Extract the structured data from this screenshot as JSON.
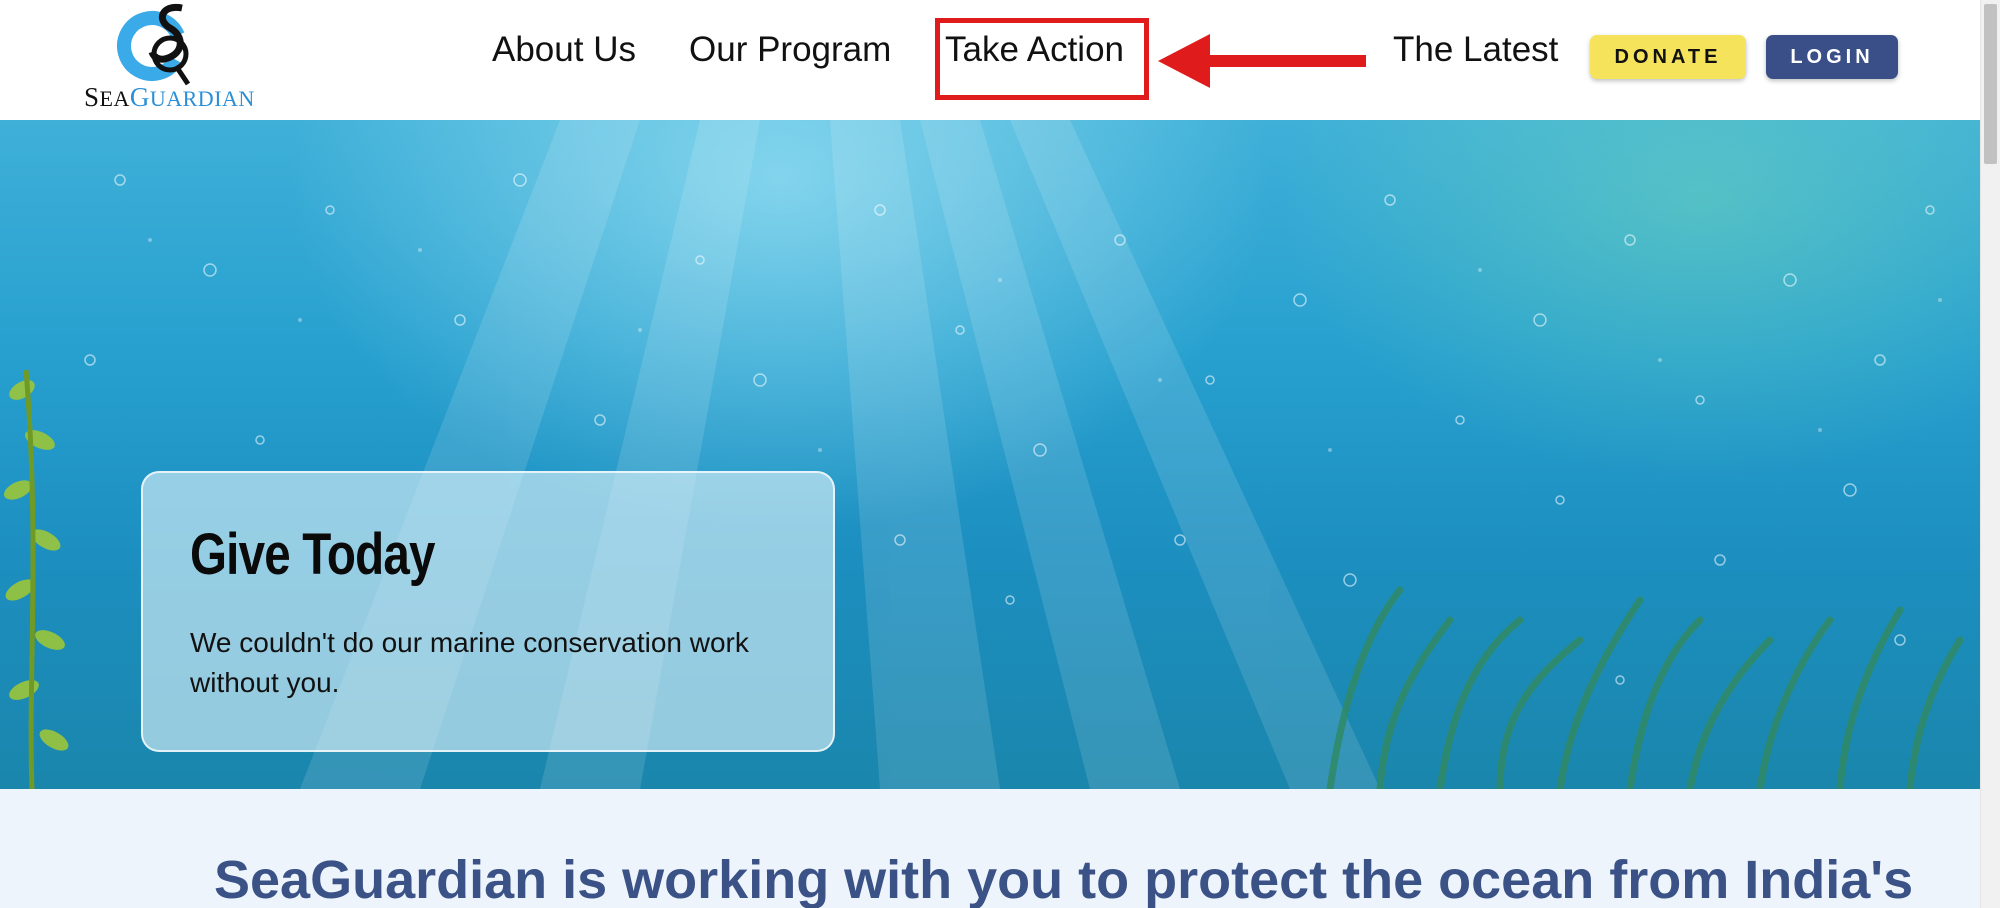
{
  "brand": {
    "logo_text_first": "S",
    "logo_text_mid": "EA",
    "logo_text_accent_first": "G",
    "logo_text_accent_rest": "UARDIAN",
    "accent_color": "#2a8fd6"
  },
  "nav": {
    "items": [
      {
        "label": "About Us"
      },
      {
        "label": "Our Program"
      },
      {
        "label": "Take Action"
      },
      {
        "label": "The Latest"
      }
    ],
    "highlighted_item": "Take Action",
    "highlight_color": "#e01b1b"
  },
  "actions": {
    "donate_label": "DONATE",
    "login_label": "LOGIN",
    "donate_color": "#f5e35b",
    "login_color": "#3a4f87"
  },
  "hero": {
    "title": "Give Today",
    "text": "We couldn't do our marine conservation work without you."
  },
  "mission": {
    "headline": "SeaGuardian is working with you to protect the ocean from India's"
  }
}
